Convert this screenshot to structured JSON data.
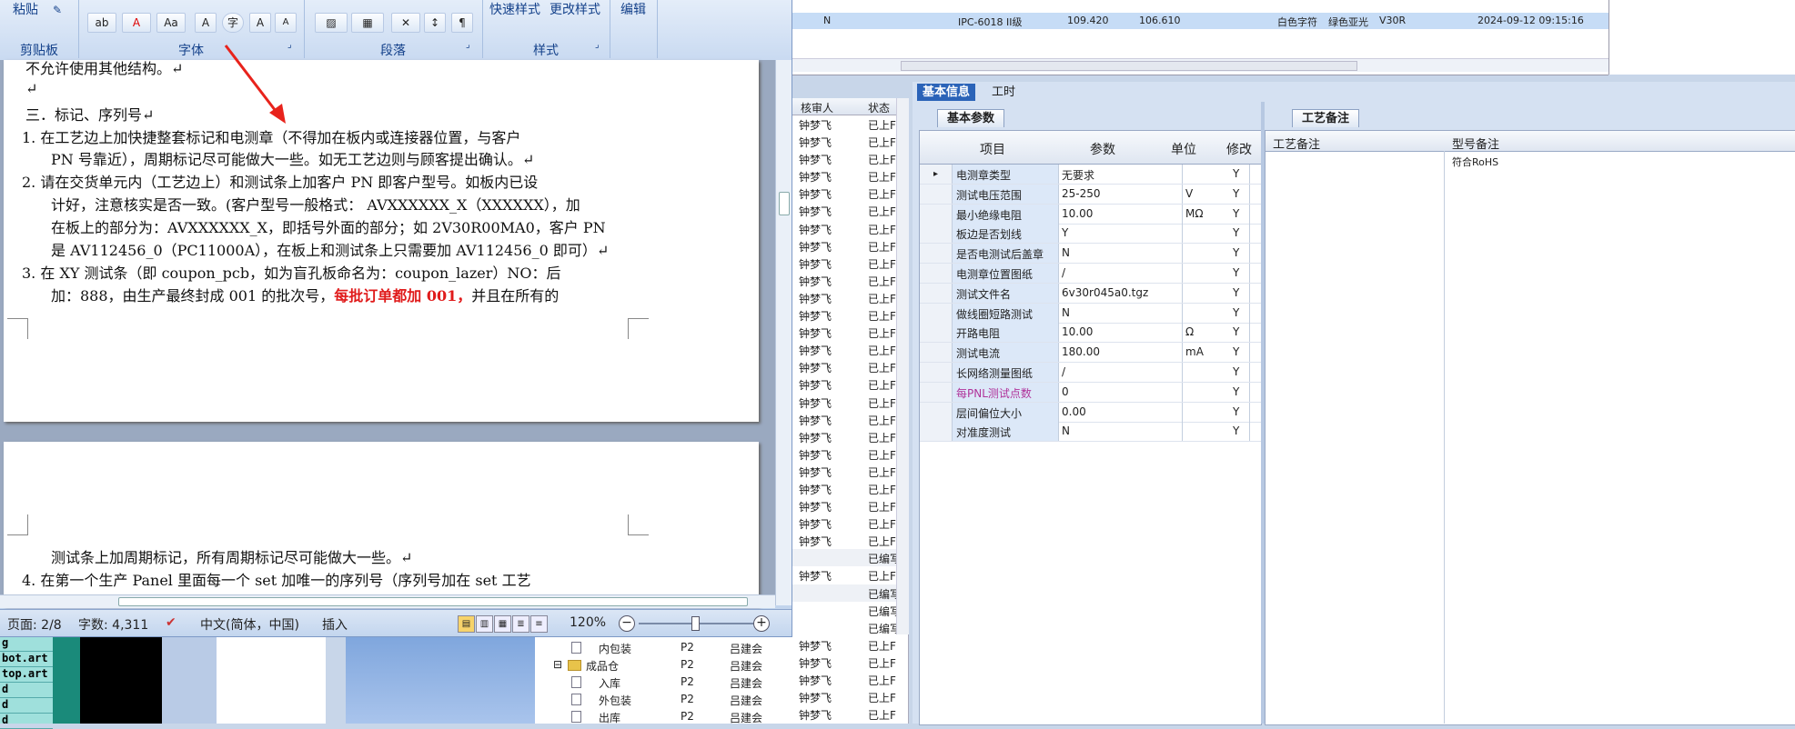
{
  "word": {
    "ribbon": {
      "groups": {
        "clipboard": "剪贴板",
        "font": "字体",
        "paragraph": "段落",
        "styles": "样式"
      },
      "paste_label": "粘贴",
      "quick_styles": "快速样式",
      "change_styles": "更改样式",
      "edit": "编辑",
      "btn_font_color": "A",
      "btn_aa": "Aa",
      "btn_char_border": "A",
      "btn_circle": "字",
      "btn_grow": "A",
      "btn_shrink": "A"
    },
    "doc": {
      "lines": [
        "不允许使用其他结构。↵",
        "↵",
        "三．标记、序列号↵",
        "1.  在工艺边上加快捷整套标记和电测章（不得加在板内或连接器位置，与客户",
        "PN 号靠近），周期标记尽可能做大一些。如无工艺边则与顾客提出确认。↵",
        "2.  请在交货单元内（工艺边上）和测试条上加客户 PN 即客户型号。如板内已设",
        "计好，注意核实是否一致。(客户型号一般格式： AVXXXXXX_X（XXXXXX），加",
        "在板上的部分为：AVXXXXXX_X，即括号外面的部分；如 2V30R00MA0，客户 PN",
        "是 AV112456_0（PC11000A），在板上和测试条上只需要加 AV112456_0 即可）↵",
        "3.  在 XY 测试条（即 coupon_pcb，如为盲孔板命名为：coupon_lazer）NO：后",
        "加：888，由生产最终封成 001 的批次号，",
        "每批订单都加 001，",
        "并且在所有的",
        "测试条上加周期标记，所有周期标记尽可能做大一些。↵",
        "4.  在第一个生产 Panel 里面每一个 set 加唯一的序列号（序列号加在 set 工艺"
      ]
    },
    "status": {
      "page": "页面: 2/8",
      "words": "字数: 4,311",
      "lang": "中文(简体，中国)",
      "insert": "插入",
      "zoom": "120%"
    }
  },
  "top_table": {
    "row": [
      "N",
      "IPC-6018 II级",
      "109.420",
      "106.610",
      "白色字符",
      "绿色亚光",
      "V30R",
      "2024-09-12 09:15:16"
    ]
  },
  "mid_list": {
    "headers": [
      "核审人",
      "状态"
    ],
    "name": "钟梦飞",
    "status_uploaded": "已上F",
    "status_edited": "已编写",
    "rows": [
      [
        "钟梦飞",
        "已上F"
      ],
      [
        "钟梦飞",
        "已上F"
      ],
      [
        "钟梦飞",
        "已上F"
      ],
      [
        "钟梦飞",
        "已上F"
      ],
      [
        "钟梦飞",
        "已上F"
      ],
      [
        "钟梦飞",
        "已上F"
      ],
      [
        "钟梦飞",
        "已上F"
      ],
      [
        "钟梦飞",
        "已上F"
      ],
      [
        "钟梦飞",
        "已上F"
      ],
      [
        "钟梦飞",
        "已上F"
      ],
      [
        "钟梦飞",
        "已上F"
      ],
      [
        "钟梦飞",
        "已上F"
      ],
      [
        "钟梦飞",
        "已上F"
      ],
      [
        "钟梦飞",
        "已上F"
      ],
      [
        "钟梦飞",
        "已上F"
      ],
      [
        "钟梦飞",
        "已上F"
      ],
      [
        "钟梦飞",
        "已上F"
      ],
      [
        "钟梦飞",
        "已上F"
      ],
      [
        "钟梦飞",
        "已上F"
      ],
      [
        "钟梦飞",
        "已上F"
      ],
      [
        "钟梦飞",
        "已上F"
      ],
      [
        "钟梦飞",
        "已上F"
      ],
      [
        "钟梦飞",
        "已上F"
      ],
      [
        "钟梦飞",
        "已上F"
      ],
      [
        "钟梦飞",
        "已上F"
      ],
      [
        "",
        "已编写"
      ],
      [
        "钟梦飞",
        "已上F"
      ],
      [
        "",
        "已编写"
      ],
      [
        "",
        "已编写"
      ],
      [
        "",
        "已编写"
      ],
      [
        "钟梦飞",
        "已上F"
      ],
      [
        "钟梦飞",
        "已上F"
      ],
      [
        "钟梦飞",
        "已上F"
      ],
      [
        "钟梦飞",
        "已上F"
      ],
      [
        "钟梦飞",
        "已上F"
      ]
    ]
  },
  "tree": {
    "rows": [
      {
        "label": "内包装",
        "level": "P2",
        "owner": "吕建会",
        "type": "doc"
      },
      {
        "label": "成品仓",
        "level": "P2",
        "owner": "吕建会",
        "type": "folder"
      },
      {
        "label": "入库",
        "level": "P2",
        "owner": "吕建会",
        "type": "doc"
      },
      {
        "label": "外包装",
        "level": "P2",
        "owner": "吕建会",
        "type": "doc"
      },
      {
        "label": "出库",
        "level": "P2",
        "owner": "吕建会",
        "type": "doc"
      }
    ]
  },
  "left_strip": [
    "g",
    "bot.art",
    "top.art",
    "d",
    "d",
    "d"
  ],
  "right_panel": {
    "tabs": [
      "基本信息",
      "工时"
    ],
    "subtab_left": "基本参数",
    "subtab_right": "工艺备注",
    "grid_headers": [
      "项目",
      "参数",
      "单位",
      "修改"
    ],
    "params": [
      [
        "电测章类型",
        "无要求",
        "",
        "Y"
      ],
      [
        "测试电压范围",
        "25-250",
        "V",
        "Y"
      ],
      [
        "最小绝缘电阻",
        "10.00",
        "MΩ",
        "Y"
      ],
      [
        "板边是否划线",
        "Y",
        "",
        "Y"
      ],
      [
        "是否电测试后盖章",
        "N",
        "",
        "Y"
      ],
      [
        "电测章位置图纸",
        "/",
        "",
        "Y"
      ],
      [
        "测试文件名",
        "6v30r045a0.tgz",
        "",
        "Y"
      ],
      [
        "做线圈短路测试",
        "N",
        "",
        "Y"
      ],
      [
        "开路电阻",
        "10.00",
        "Ω",
        "Y"
      ],
      [
        "测试电流",
        "180.00",
        "mA",
        "Y"
      ],
      [
        "长网络测量图纸",
        "/",
        "",
        "Y"
      ],
      [
        "每PNL测试点数",
        "0",
        "",
        "Y"
      ],
      [
        "层间偏位大小",
        "0.00",
        "",
        "Y"
      ],
      [
        "对准度测试",
        "N",
        "",
        "Y"
      ]
    ],
    "remarks_headers": [
      "工艺备注",
      "型号备注"
    ],
    "remarks_value": "符合RoHS",
    "highlight_color": "#b0339a"
  }
}
